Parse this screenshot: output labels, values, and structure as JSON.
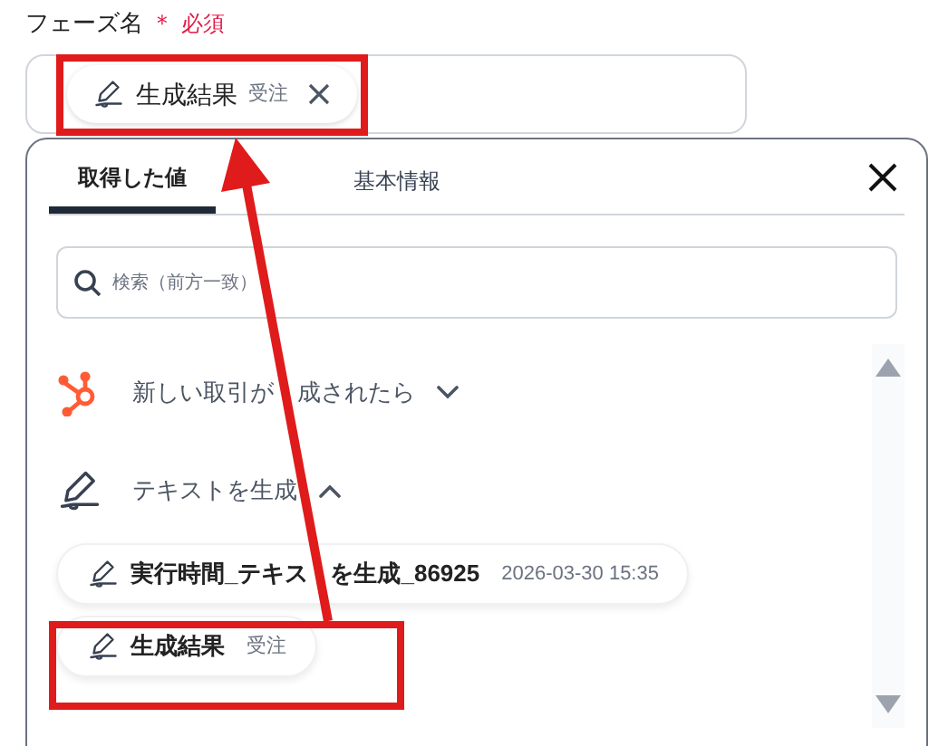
{
  "field": {
    "label": "フェーズ名",
    "required_mark": "＊",
    "required": "必須",
    "chip": {
      "name": "生成結果",
      "tag": "受注"
    }
  },
  "tabs": [
    {
      "label": "取得した値",
      "selected": true
    },
    {
      "label": "基本情報",
      "selected": false
    }
  ],
  "search": {
    "placeholder": "検索（前方一致）"
  },
  "groups": [
    {
      "kind": "hubspot",
      "title_parts": [
        "新しい取引が",
        "成されたら"
      ],
      "expanded": false
    },
    {
      "kind": "pen",
      "title_parts": [
        "テキストを生成"
      ],
      "expanded": true,
      "items": [
        {
          "name_parts": [
            "実行時間_テキス",
            "を生成_86925"
          ],
          "value": "2026-03-30 15:35"
        },
        {
          "name_parts": [
            "生成結果"
          ],
          "value": "受注"
        }
      ]
    }
  ]
}
